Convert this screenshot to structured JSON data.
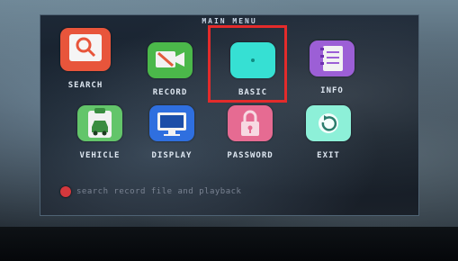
{
  "menu": {
    "title": "MAIN MENU",
    "items": [
      {
        "label": "SEARCH",
        "icon": "search-icon",
        "color": "#e8553b"
      },
      {
        "label": "RECORD",
        "icon": "record-icon",
        "color": "#4bb84a"
      },
      {
        "label": "BASIC",
        "icon": "basic-icon",
        "color": "#36e0d3"
      },
      {
        "label": "INFO",
        "icon": "info-icon",
        "color": "#9c5fd6"
      },
      {
        "label": "VEHICLE",
        "icon": "vehicle-icon",
        "color": "#63c56a"
      },
      {
        "label": "DISPLAY",
        "icon": "display-icon",
        "color": "#2f6fdf"
      },
      {
        "label": "PASSWORD",
        "icon": "lock-icon",
        "color": "#e66b92"
      },
      {
        "label": "EXIT",
        "icon": "exit-icon",
        "color": "#8df0d8"
      }
    ],
    "selected": "BASIC",
    "selection_color": "#e32b2b"
  },
  "status": {
    "text": "search record file and playback",
    "indicator_color": "#d4383d"
  }
}
